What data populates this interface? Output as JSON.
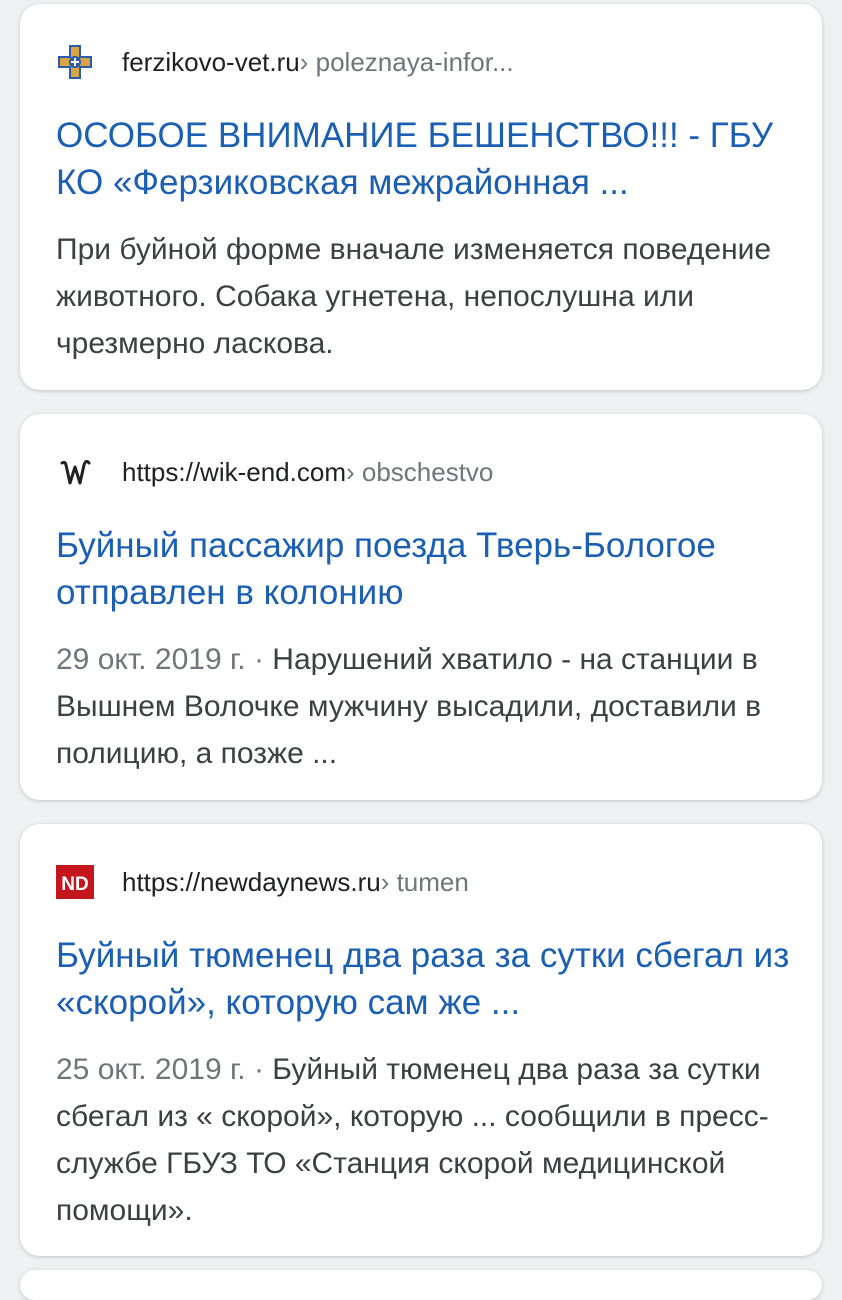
{
  "results": [
    {
      "site": "ferzikovo-vet.ru",
      "path": " › poleznaya-infor...",
      "favicon": "vet-cross-icon",
      "title": "ОСОБОЕ ВНИМАНИЕ БЕШЕНСТВО!!! - ГБУ КО «Ферзиковская межрайонная ...",
      "date": "",
      "snippet": "При буйной форме вначале изменяется поведение животного. Собака угнетена, непослушна или чрезмерно ласкова."
    },
    {
      "site": "https://wik-end.com",
      "path": " › obschestvo",
      "favicon": "wik-end-w-icon",
      "title": "Буйный пассажир поезда Тверь-Бологое отправлен в колонию",
      "date": "29 окт. 2019 г. · ",
      "snippet": "Нарушений хватило - на станции в Вышнем Волочке мужчину высадили, доставили в полицию, а позже ..."
    },
    {
      "site": "https://newdaynews.ru",
      "path": " › tumen",
      "favicon": "nd-logo-icon",
      "favicon_text": "ND",
      "title": "Буйный тюменец два раза за сутки сбегал из «скорой», которую сам же ...",
      "date": "25 окт. 2019 г. · ",
      "snippet": "Буйный тюменец два раза за сутки сбегал из « скорой», которую ... сообщили в пресс- службе ГБУЗ ТО «Станция скорой медицинской помощи»."
    }
  ],
  "colors": {
    "title_link": "#1a5fb4",
    "snippet_text": "#3c4043",
    "meta_gray": "#70757a",
    "nd_red": "#c4161c"
  }
}
